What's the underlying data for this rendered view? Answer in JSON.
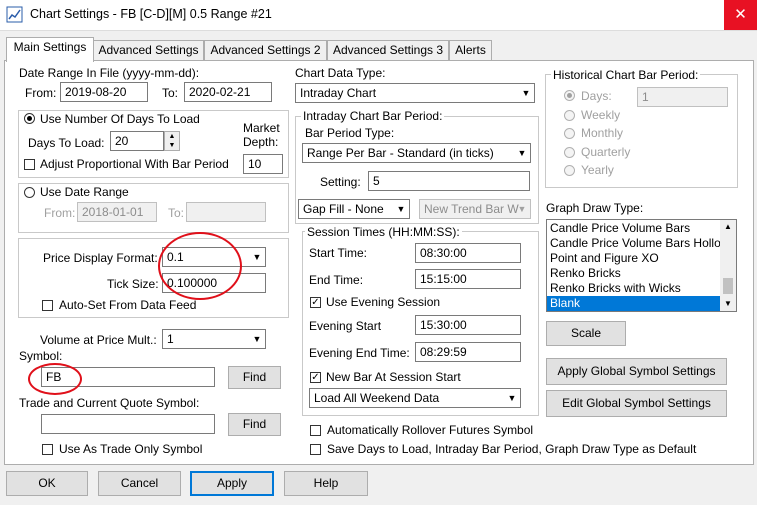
{
  "window": {
    "title": "Chart Settings - FB [C-D][M]  0.5 Range  #21"
  },
  "tabs": [
    "Main Settings",
    "Advanced Settings",
    "Advanced Settings 2",
    "Advanced Settings 3",
    "Alerts"
  ],
  "date_range": {
    "title": "Date Range In File (yyyy-mm-dd):",
    "from_label": "From:",
    "from_value": "2019-08-20",
    "to_label": "To:",
    "to_value": "2020-02-21"
  },
  "days_group": {
    "radio_label": "Use Number Of Days To Load",
    "days_label": "Days To Load:",
    "days_value": "20",
    "market_depth_label_1": "Market",
    "market_depth_label_2": "Depth:",
    "market_depth_value": "10",
    "adjust_label": "Adjust Proportional With Bar Period"
  },
  "date_range_group": {
    "radio_label": "Use Date Range",
    "from_label": "From:",
    "from_value": "2018-01-01",
    "to_label": "To:",
    "to_value": ""
  },
  "price": {
    "display_format_label": "Price Display Format:",
    "display_format_value": "0.1",
    "tick_size_label": "Tick Size:",
    "tick_size_value": "0.100000",
    "autoset_label": "Auto-Set From Data Feed"
  },
  "volume": {
    "label": "Volume at Price Mult.:",
    "value": "1"
  },
  "symbol": {
    "label": "Symbol:",
    "value": "FB",
    "find_label": "Find"
  },
  "trade_symbol": {
    "label": "Trade and Current Quote Symbol:",
    "value": "",
    "find_label": "Find",
    "trade_only_label": "Use As Trade Only Symbol"
  },
  "chart_data_type": {
    "label": "Chart Data Type:",
    "value": "Intraday Chart"
  },
  "intraday": {
    "title": "Intraday Chart Bar Period:",
    "bar_period_type_label": "Bar Period Type:",
    "bar_period_type_value": "Range Per Bar - Standard (in ticks)",
    "setting_label": "Setting:",
    "setting_value": "5",
    "gap_fill_value": "Gap Fill - None",
    "new_trend_value": "New Trend Bar W"
  },
  "session": {
    "title": "Session Times (HH:MM:SS):",
    "start_label": "Start Time:",
    "start_value": "08:30:00",
    "end_label": "End Time:",
    "end_value": "15:15:00",
    "evening_label": "Use Evening Session",
    "evening_start_label": "Evening Start",
    "evening_start_value": "15:30:00",
    "evening_end_label": "Evening End Time:",
    "evening_end_value": "08:29:59",
    "new_bar_label": "New Bar At Session Start",
    "weekend_value": "Load All Weekend Data"
  },
  "rollover_label": "Automatically Rollover Futures Symbol",
  "save_default_label": "Save Days to Load, Intraday Bar Period, Graph Draw Type as Default",
  "historical": {
    "title": "Historical Chart Bar Period:",
    "days_label": "Days:",
    "days_value": "1",
    "weekly_label": "Weekly",
    "monthly_label": "Monthly",
    "quarterly_label": "Quarterly",
    "yearly_label": "Yearly"
  },
  "graph_draw": {
    "label": "Graph Draw Type:",
    "items": [
      "Candle Price Volume Bars",
      "Candle Price Volume Bars Hollo",
      "Point and Figure XO",
      "Renko Bricks",
      "Renko Bricks with Wicks",
      "Blank"
    ],
    "selected": "Blank"
  },
  "buttons": {
    "scale": "Scale",
    "apply_global": "Apply Global Symbol Settings",
    "edit_global": "Edit Global Symbol Settings",
    "ok": "OK",
    "cancel": "Cancel",
    "apply": "Apply",
    "help": "Help"
  },
  "colors": {
    "accent": "#0078d7",
    "annotation": "#e0101a",
    "close": "#e81123"
  }
}
